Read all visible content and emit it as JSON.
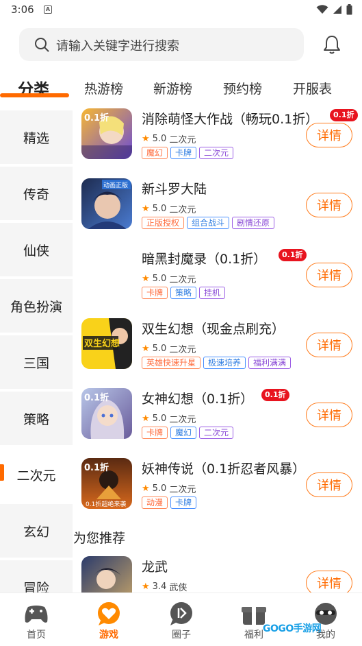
{
  "status": {
    "time": "3:06",
    "notif_glyph": "A"
  },
  "search": {
    "placeholder": "请输入关键字进行搜索"
  },
  "tabs": [
    {
      "label": "分类",
      "active": true
    },
    {
      "label": "热游榜"
    },
    {
      "label": "新游榜"
    },
    {
      "label": "预约榜"
    },
    {
      "label": "开服表"
    }
  ],
  "categories": [
    {
      "label": "精选"
    },
    {
      "label": "传奇"
    },
    {
      "label": "仙侠"
    },
    {
      "label": "角色扮演"
    },
    {
      "label": "三国"
    },
    {
      "label": "策略"
    },
    {
      "label": "二次元",
      "active": true
    },
    {
      "label": "玄幻"
    },
    {
      "label": "冒险"
    }
  ],
  "games": [
    {
      "name": "消除萌怪大作战（畅玩0.1折）",
      "badge": "0.1折",
      "rating": "5.0",
      "genre": "二次元",
      "tags": [
        "魔幻",
        "卡牌",
        "二次元"
      ],
      "action": "详情",
      "thumb_colors": [
        "#f7b733",
        "#6a4bd6"
      ]
    },
    {
      "name": "新斗罗大陆",
      "badge": "",
      "rating": "5.0",
      "genre": "二次元",
      "tags": [
        "正版授权",
        "组合战斗",
        "剧情还原"
      ],
      "action": "详情",
      "thumb_colors": [
        "#1d2b4f",
        "#4a7bd1"
      ]
    },
    {
      "name": "暗黑封魔录（0.1折）",
      "badge": "0.1折",
      "rating": "5.0",
      "genre": "二次元",
      "tags": [
        "卡牌",
        "策略",
        "挂机"
      ],
      "action": "详情",
      "thumb_colors": [
        "#ffffff",
        "#ffffff"
      ]
    },
    {
      "name": "双生幻想（现金点刷充）",
      "badge": "",
      "rating": "5.0",
      "genre": "二次元",
      "tags": [
        "英雄快速升星",
        "极速培养",
        "福利满满"
      ],
      "action": "详情",
      "thumb_colors": [
        "#f9d21a",
        "#222222"
      ]
    },
    {
      "name": "女神幻想（0.1折）",
      "badge": "0.1折",
      "rating": "5.0",
      "genre": "二次元",
      "tags": [
        "卡牌",
        "魔幻",
        "二次元"
      ],
      "action": "详情",
      "thumb_colors": [
        "#b8c6e8",
        "#6a5c9b"
      ]
    },
    {
      "name": "妖神传说（0.1折忍者风暴）",
      "badge": "",
      "rating": "5.0",
      "genre": "二次元",
      "tags": [
        "动漫",
        "卡牌"
      ],
      "action": "详情",
      "thumb_colors": [
        "#5a2a12",
        "#d8691d"
      ]
    }
  ],
  "recommend": {
    "title": "为您推荐",
    "game": {
      "name": "龙武",
      "rating": "3.4",
      "genre": "武侠",
      "action": "详情",
      "thumb_colors": [
        "#2b3b6b",
        "#c7a56a"
      ]
    }
  },
  "thumb_texts": {
    "g0": "0.1折",
    "g1": "动画正版",
    "g3": "双生幻想",
    "g4": "0.1折",
    "g5": "0.1折",
    "g5_sub": "0.1折超绝来袭"
  },
  "bottom_nav": [
    {
      "label": "首页"
    },
    {
      "label": "游戏",
      "active": true
    },
    {
      "label": "圈子"
    },
    {
      "label": "福利"
    },
    {
      "label": "我的"
    }
  ],
  "watermark": "GOGO手游网",
  "colors": {
    "accent": "#ff6a00",
    "badge_red": "#e8141f",
    "star": "#ff8a00"
  }
}
